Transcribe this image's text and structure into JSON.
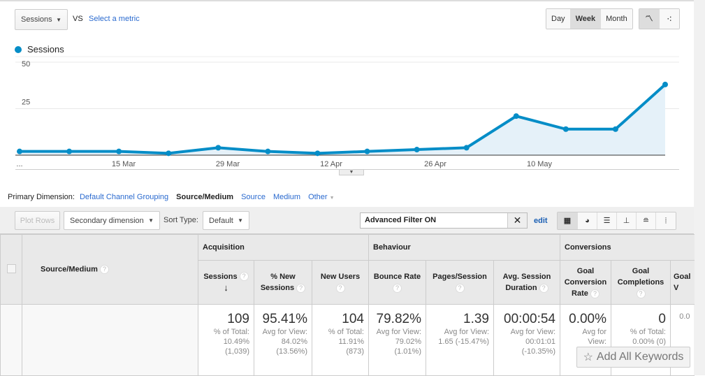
{
  "toolbar_top": {
    "metric": "Sessions",
    "vs": "VS",
    "select_metric": "Select a metric",
    "periods": [
      "Day",
      "Week",
      "Month"
    ],
    "active_period": "Week"
  },
  "legend": {
    "label": "Sessions",
    "color": "#058dc7"
  },
  "chart_data": {
    "type": "area",
    "x_tick_labels": [
      "...",
      "15 Mar",
      "29 Mar",
      "12 Apr",
      "26 Apr",
      "10 May"
    ],
    "y_ticks": [
      25,
      50
    ],
    "ylim": [
      0,
      50
    ],
    "series": [
      {
        "name": "Sessions",
        "values": [
          2,
          2,
          2,
          1,
          4,
          2,
          1,
          2,
          3,
          4,
          21,
          14,
          14,
          38
        ]
      }
    ],
    "grid": true,
    "color": "#058dc7",
    "fill": "#e5f1f9"
  },
  "dimension": {
    "label": "Primary Dimension:",
    "options": [
      "Default Channel Grouping",
      "Source/Medium",
      "Source",
      "Medium",
      "Other"
    ],
    "active": "Source/Medium"
  },
  "table_toolbar": {
    "plot_rows": "Plot Rows",
    "secondary": "Secondary dimension",
    "sort_label": "Sort Type:",
    "sort_value": "Default",
    "filter_value": "Advanced Filter ON",
    "edit": "edit"
  },
  "table": {
    "first_header": "Source/Medium",
    "groups": [
      "Acquisition",
      "Behaviour",
      "Conversions"
    ],
    "columns": [
      "Sessions",
      "% New Sessions",
      "New Users",
      "Bounce Rate",
      "Pages/Session",
      "Avg. Session Duration",
      "Goal Conversion Rate",
      "Goal Completions",
      "Goal V"
    ],
    "totals": [
      {
        "value": "109",
        "sub": [
          "% of Total:",
          "10.49%",
          "(1,039)"
        ]
      },
      {
        "value": "95.41%",
        "sub": [
          "Avg for View:",
          "84.02%",
          "(13.56%)"
        ]
      },
      {
        "value": "104",
        "sub": [
          "% of Total:",
          "11.91%",
          "(873)"
        ]
      },
      {
        "value": "79.82%",
        "sub": [
          "Avg for View:",
          "79.02%",
          "(1.01%)"
        ]
      },
      {
        "value": "1.39",
        "sub": [
          "Avg for View:",
          "1.65 (-15.47%)",
          ""
        ]
      },
      {
        "value": "00:00:54",
        "sub": [
          "Avg for View:",
          "00:01:01",
          "(-10.35%)"
        ]
      },
      {
        "value": "0.00%",
        "sub": [
          "Avg for",
          "View:",
          ""
        ]
      },
      {
        "value": "0",
        "sub": [
          "% of Total:",
          "0.00% (0)",
          ""
        ]
      },
      {
        "value": "",
        "sub": [
          "",
          "0.0",
          ""
        ]
      }
    ]
  },
  "add_keywords": "Add All Keywords"
}
